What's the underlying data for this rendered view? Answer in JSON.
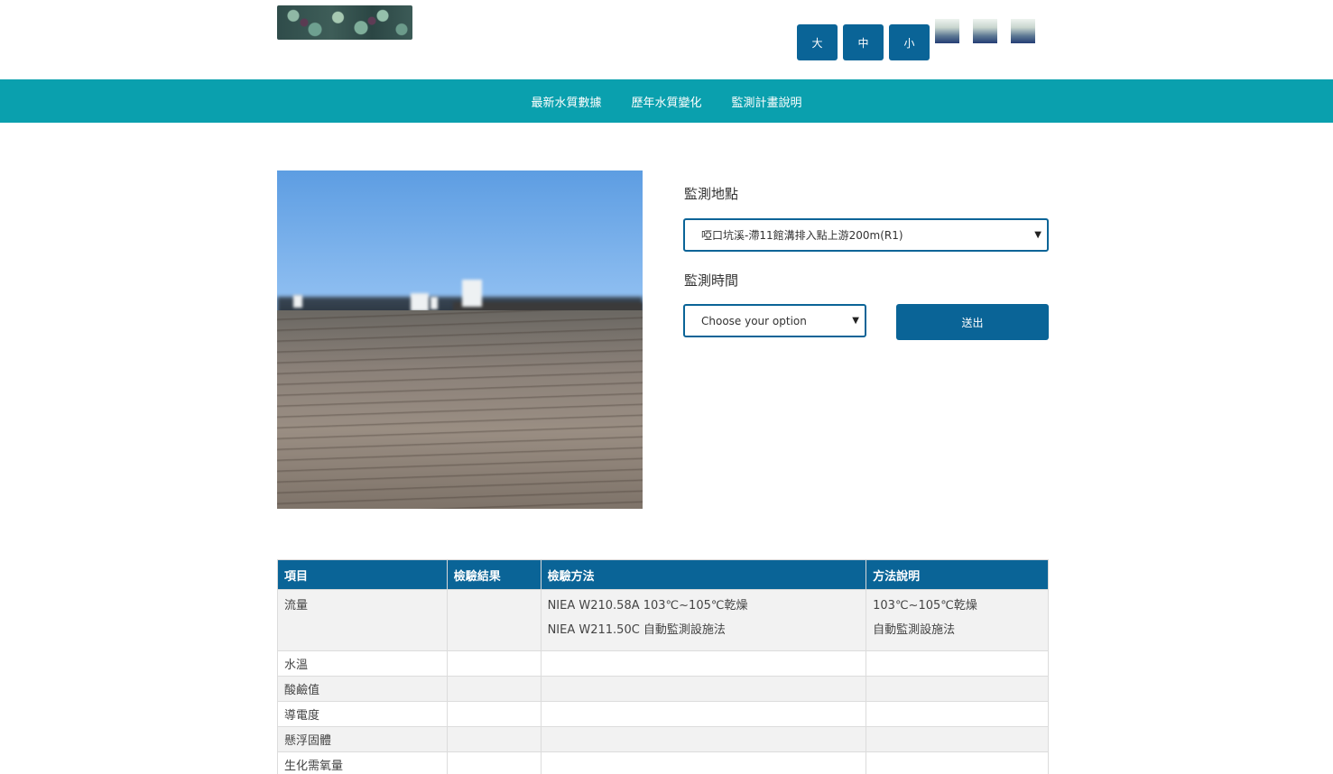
{
  "header": {
    "font_size_buttons": [
      "大",
      "中",
      "小"
    ],
    "theme_swatches": [
      "theme-1",
      "theme-2",
      "theme-3"
    ]
  },
  "nav": {
    "items": [
      "最新水質數據",
      "歷年水質變化",
      "監測計畫說明"
    ]
  },
  "form": {
    "location_label": "監測地點",
    "location_value": "啞口坑溪-滯11館溝排入點上游200m(R1)",
    "time_label": "監測時間",
    "time_value": "Choose your option",
    "submit_label": "送出"
  },
  "table": {
    "headers": [
      "項目",
      "檢驗結果",
      "檢驗方法",
      "方法說明"
    ],
    "rows": [
      {
        "item": "流量",
        "result": "",
        "methods": [
          "NIEA W210.58A 103℃~105℃乾燥",
          "NIEA W211.50C 自動監測設施法"
        ],
        "notes": [
          "103℃~105℃乾燥",
          "自動監測設施法"
        ]
      },
      {
        "item": "水溫",
        "result": "",
        "methods": [],
        "notes": []
      },
      {
        "item": "酸鹼值",
        "result": "",
        "methods": [],
        "notes": []
      },
      {
        "item": "導電度",
        "result": "",
        "methods": [],
        "notes": []
      },
      {
        "item": "懸浮固體",
        "result": "",
        "methods": [],
        "notes": []
      },
      {
        "item": "生化需氧量",
        "result": "",
        "methods": [],
        "notes": []
      }
    ]
  },
  "colors": {
    "nav_bg": "#0aa0ae",
    "primary": "#0a6497"
  }
}
